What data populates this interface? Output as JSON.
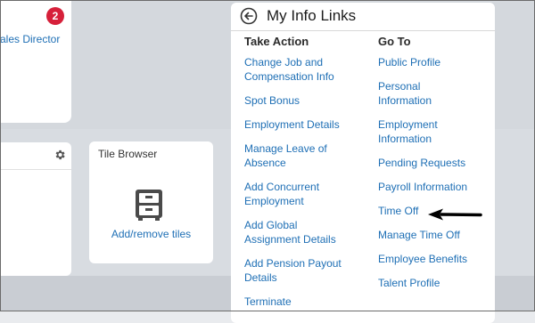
{
  "left_card": {
    "role_text": "ales Director",
    "badge_count": "2"
  },
  "side_card": {
    "icon": "gear-icon"
  },
  "tile_browser": {
    "title": "Tile Browser",
    "add_remove_label": "Add/remove tiles",
    "icon": "filing-cabinet-icon"
  },
  "panel": {
    "title": "My Info Links",
    "back_icon": "back-arrow-icon",
    "take_action": {
      "heading": "Take Action",
      "links": [
        "Change Job and\nCompensation Info",
        "Spot Bonus",
        "Employment Details",
        "Manage Leave of\nAbsence",
        "Add Concurrent\nEmployment",
        "Add Global\nAssignment Details",
        "Add Pension Payout\nDetails",
        "Terminate"
      ]
    },
    "go_to": {
      "heading": "Go To",
      "links": [
        "Public Profile",
        "Personal\nInformation",
        "Employment\nInformation",
        "Pending Requests",
        "Payroll Information",
        "Time Off",
        "Manage Time Off",
        "Employee Benefits",
        "Talent Profile"
      ]
    }
  },
  "annotation": {
    "icon": "pointer-arrow-icon"
  }
}
